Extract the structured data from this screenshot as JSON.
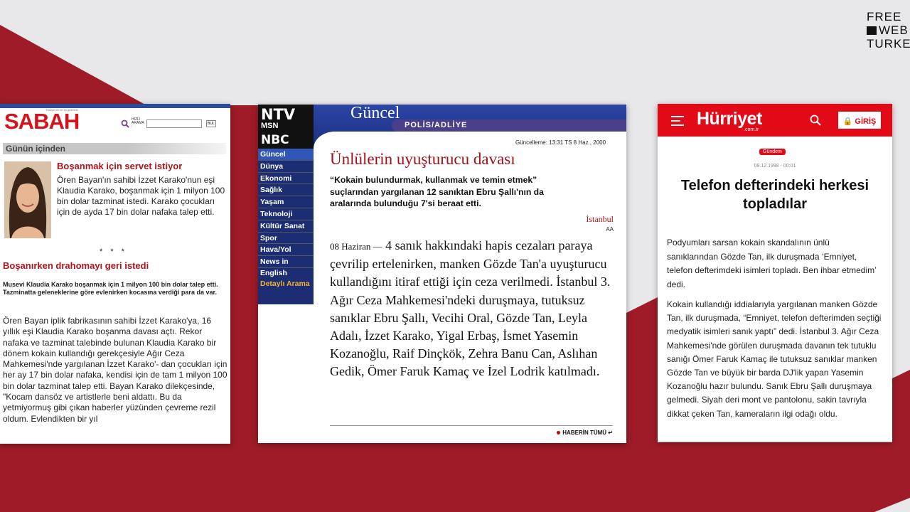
{
  "brand": {
    "line1": "FREE",
    "line2": "WEB",
    "line3": "TURKEY"
  },
  "sabah": {
    "tagline": "Türkiye'nin en iyi gazetesi",
    "logo": "SABAH",
    "search_label": "HIZLI ARAMA :",
    "search_button": "BUL",
    "section": "Günün içinden",
    "headline1": "Boşanmak için servet istiyor",
    "para1": "Ören Bayan'ın sahibi İzzet Karako'nun eşi Klaudia Karako, boşanmak için 1 milyon 100 bin dolar tazminat istedi. Karako çocukları için de ayda 17 bin dolar nafaka talep etti.",
    "stars": "* * *",
    "headline2": "Boşanırken drahomayı geri istedi",
    "subhead": "Musevi Klaudia Karako boşanmak için 1 milyon 100 bin dolar talep etti. Tazminatta geleneklerine göre evlenirken kocasına verdiği para da var.",
    "para2": "Ören Bayan iplik fabrikasının sahibi İzzet Karako'ya, 16 yıllık eşi Klaudia Karako boşanma davası açtı. Rekor nafaka ve tazminat talebinde bulunan Klaudia Karako bir dönem kokain kullandığı gerekçesiyle Ağır Ceza Mahkemesi'nde yargılanan İzzet Karako'- dan çocukları için her ay 17 bin dolar nafaka, kendisi için de tam 1 milyon 100 bin dolar tazminat talep etti. Bayan Karako dilekçesinde, \"Kocam dansöz ve artistlerle beni aldattı. Bu da yetmiyormuş gibi çıkan haberler yüzünden çevreme rezil oldum. Evlendikten bir yıl"
  },
  "ntv": {
    "logo_top": "NTV",
    "logo_mid": "MSN",
    "logo_bot": "NBC",
    "section": "Güncel",
    "category": "POLİS/ADLİYE",
    "nav": [
      "Güncel",
      "Dünya",
      "Ekonomi",
      "Sağlık",
      "Yaşam",
      "Teknoloji",
      "Kültür Sanat",
      "Spor",
      "Hava/Yol",
      "News in English"
    ],
    "nav_extra": "Detaylı Arama",
    "updated": "Güncelleme: 13:31 TS 8 Haz., 2000",
    "title": "Ünlülerin uyuşturucu davası",
    "lead": "“Kokain bulundurmak, kullanmak ve temin etmek” suçlarından yargılanan 12 sanıktan Ebru Şallı'nın da aralarında bulunduğu 7'si beraat etti.",
    "city": "İstanbul",
    "source": "AA",
    "dateline": "08 Haziran —",
    "body": "4 sanık hakkındaki hapis cezaları paraya çevrilip ertelenirken, manken Gözde Tan'a uyuşturucu kullandığını itiraf ettiği için ceza verilmedi. İstanbul 3. Ağır Ceza Mahkemesi'ndeki duruşmaya, tutuksuz sanıklar Ebru Şallı, Vecihi Oral, Gözde Tan, Leyla Adalı, İzzet Karako, Yigal Erbaş, İsmet Yasemin Kozanoğlu, Raif Dinçkök, Zehra Banu Can, Aslıhan Gedik, Ömer Faruk Kamaç ve İzel Lodrik katılmadı.",
    "more": "HABERİN TÜMÜ"
  },
  "hurriyet": {
    "logo": "Hürriyet",
    "domain": ".com.tr",
    "login": "GİRİŞ",
    "badge": "Gündem",
    "date": "08.12.1998 - 00:01",
    "title": "Telefon defterindeki herkesi topladılar",
    "para1": "Podyumları sarsan kokain skandalının ünlü sanıklarından Gözde Tan, ilk duruşmada ‘Emniyet, telefon defterimdeki isimleri topladı. Ben ihbar etmedim’ dedi.",
    "para2": "Kokain kullandığı iddialarıyla yargılanan manken Gözde Tan, ilk duruşmada, “Emniyet, telefon defterimden seçtiği medyatik isimleri sanık yaptı” dedi. İstanbul 3. Ağır Ceza Mahkemesi'nde görülen duruşmada davanın tek tutuklu sanığı Ömer Faruk Kamaç ile tutuksuz sanıklar manken Gözde Tan ve büyük bir barda DJ'lik yapan Yasemin Kozanoğlu hazır bulundu. Sanık Ebru Şallı duruşmaya gelmedi. Siyah deri mont ve pantolonu, sakin tavrıyla dikkat çeken Tan, kameraların ilgi odağı oldu."
  },
  "colors": {
    "maroon": "#9e1b27",
    "sabah_red": "#d4141c",
    "hurriyet_red": "#e20a17",
    "ntv_blue": "#1d2d73"
  }
}
